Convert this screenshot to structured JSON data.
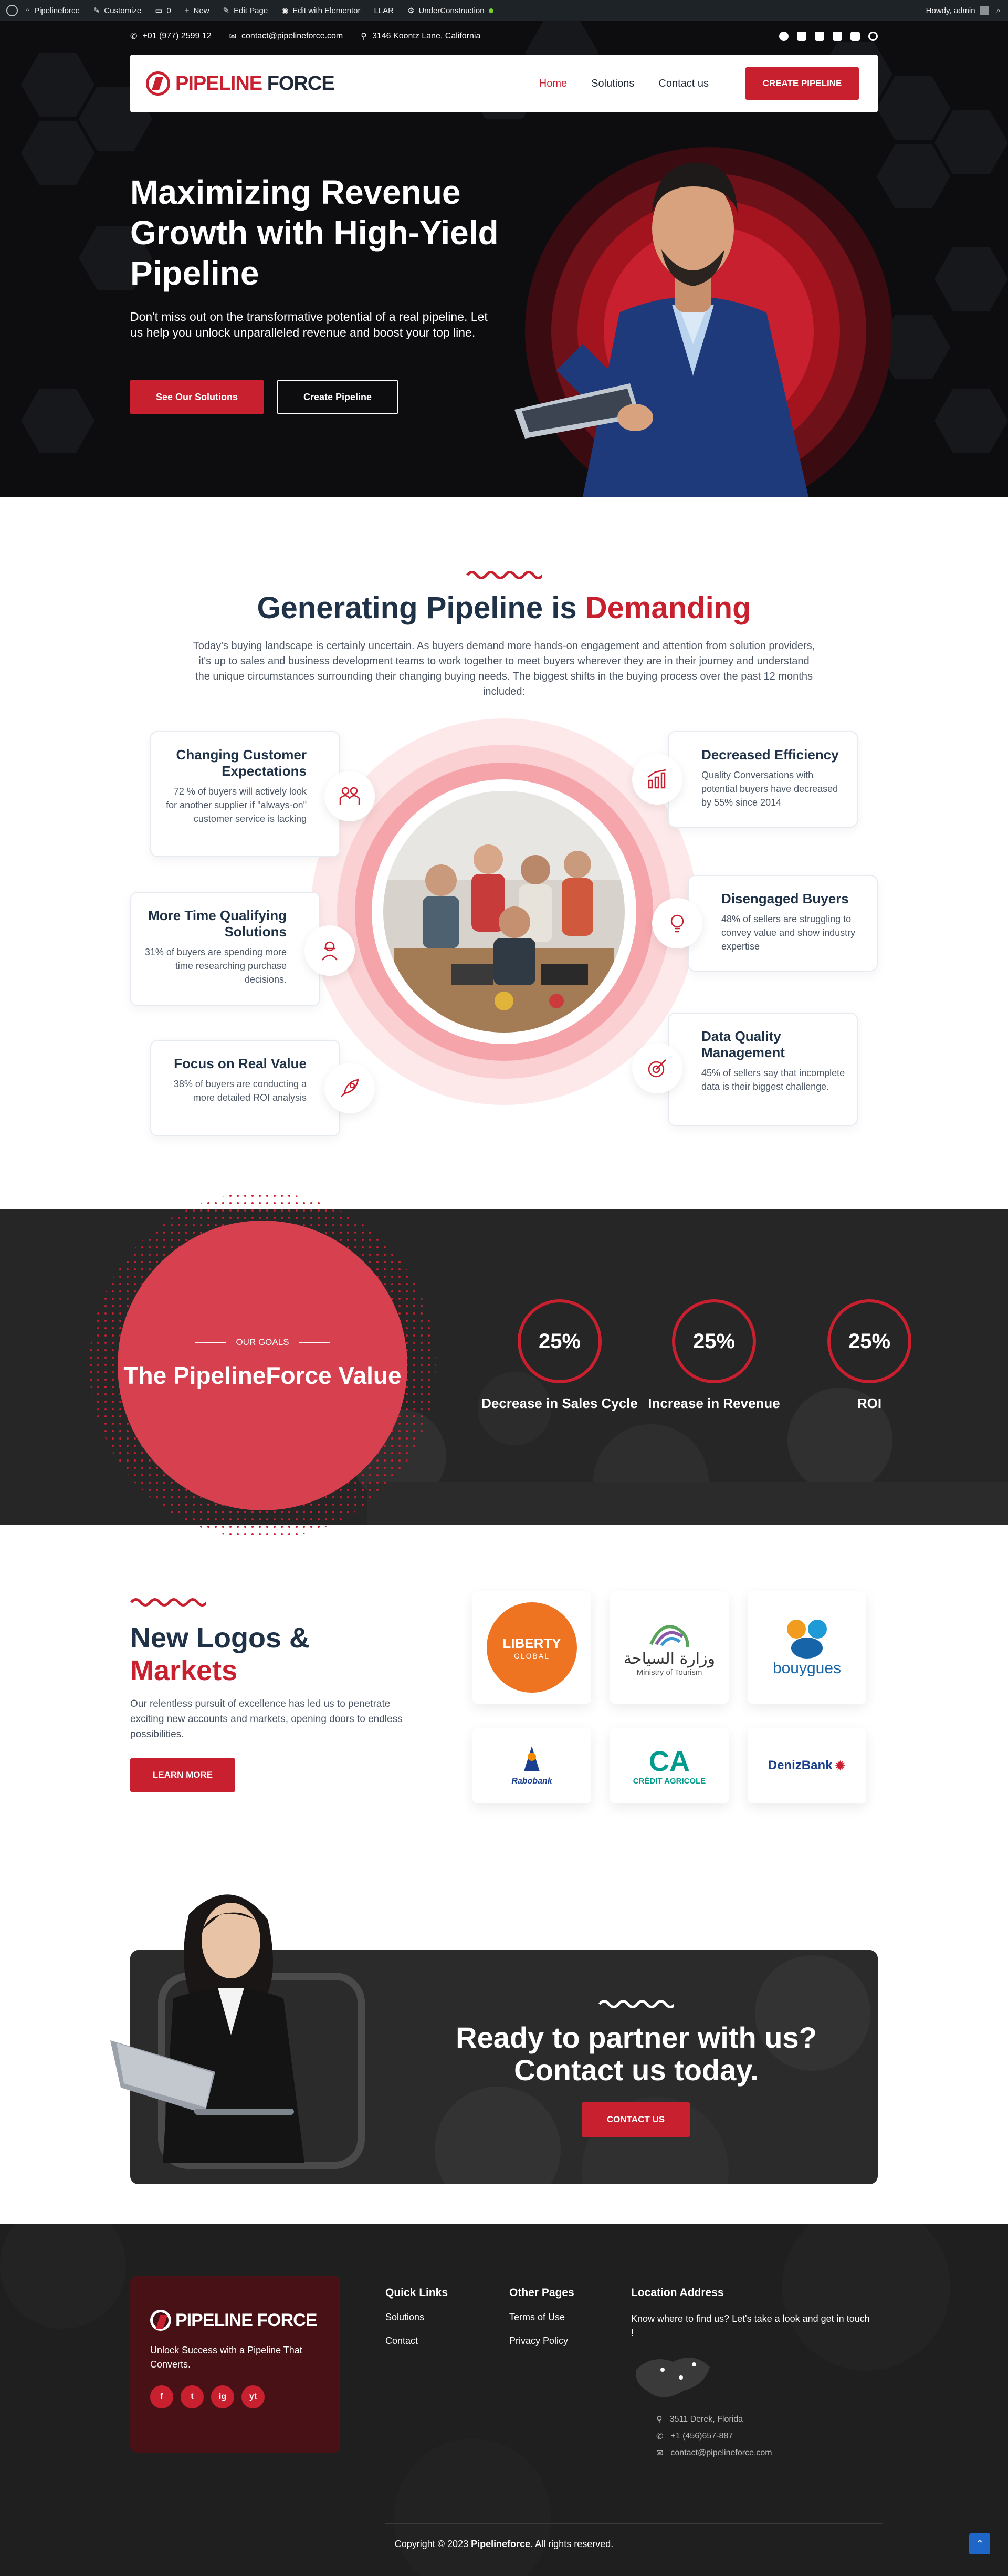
{
  "adminbar": {
    "items": [
      "Pipelineforce",
      "Customize",
      "0",
      "New",
      "Edit Page",
      "Edit with Elementor",
      "LLAR",
      "UnderConstruction"
    ],
    "greeting": "Howdy, admin"
  },
  "topbar": {
    "phone": "+01 (977) 2599 12",
    "email": "contact@pipelineforce.com",
    "address": "3146 Koontz Lane, California"
  },
  "brand": {
    "name_part1": "PIPELINE",
    "name_part2": "FORCE",
    "accent": "#c8202f",
    "dark": "#1f3247"
  },
  "nav": {
    "items": [
      "Home",
      "Solutions",
      "Contact us"
    ],
    "cta": "CREATE PIPELINE"
  },
  "hero": {
    "title": "Maximizing Revenue Growth with High-Yield Pipeline",
    "text": "Don't miss out on the transformative potential of a real pipeline. Let us help you unlock unparalleled revenue and boost your top line.",
    "btn_primary": "See Our Solutions",
    "btn_secondary": "Create Pipeline"
  },
  "generating": {
    "title_main": "Generating Pipeline is",
    "title_accent": "Demanding",
    "intro": "Today's buying landscape is certainly uncertain. As buyers demand more hands-on engagement and attention from solution providers, it's up to sales and business development teams to work together to meet buyers wherever they are in their journey and understand the unique circumstances surrounding their changing buying needs. The biggest shifts in the buying process over the past 12 months included:",
    "cards": [
      {
        "title": "Changing Customer Expectations",
        "text": "72 % of buyers will actively look for another supplier if \"always-on\" customer service is lacking",
        "icon": "people-icon"
      },
      {
        "title": "More Time Qualifying Solutions",
        "text": "31% of buyers are spending more time researching purchase decisions.",
        "icon": "person-search-icon"
      },
      {
        "title": "Focus on Real Value",
        "text": "38% of buyers are conducting a more detailed ROI analysis",
        "icon": "rocket-icon"
      },
      {
        "title": "Decreased Efficiency",
        "text": "Quality Conversations with potential buyers have decreased by 55% since 2014",
        "icon": "chart-icon"
      },
      {
        "title": "Disengaged Buyers",
        "text": "48% of sellers are struggling to convey value and show industry expertise",
        "icon": "bulb-icon"
      },
      {
        "title": "Data Quality Management",
        "text": "45% of sellers say that incomplete data is their biggest challenge.",
        "icon": "target-icon"
      }
    ]
  },
  "value": {
    "eyebrow": "OUR GOALS",
    "title": "The PipelineForce Value",
    "stats": [
      {
        "value": "25%",
        "label": "Decrease in Sales Cycle"
      },
      {
        "value": "25%",
        "label": "Increase in Revenue"
      },
      {
        "value": "25%",
        "label": "ROI"
      }
    ]
  },
  "logos": {
    "title_line1": "New Logos &",
    "title_line2": "Markets",
    "text": "Our relentless pursuit of excellence has led us to penetrate exciting new accounts and markets, opening doors to endless possibilities.",
    "button": "LEARN MORE",
    "items": [
      {
        "name": "LIBERTY",
        "sub": "GLOBAL"
      },
      {
        "name": "وزارة السياحة",
        "sub": "Ministry of Tourism"
      },
      {
        "name": "bouygues",
        "sub": ""
      },
      {
        "name": "Rabobank",
        "sub": ""
      },
      {
        "name": "CA",
        "sub": "CRÉDIT AGRICOLE"
      },
      {
        "name": "DenizBank",
        "sub": ""
      }
    ]
  },
  "cta": {
    "line1": "Ready to partner with us?",
    "line2": "Contact us today.",
    "button": "CONTACT US"
  },
  "footer": {
    "tagline": "Unlock Success with a Pipeline That Converts.",
    "social": [
      "f",
      "t",
      "ig",
      "yt"
    ],
    "quick_title": "Quick Links",
    "quick_links": [
      "Solutions",
      "Contact"
    ],
    "other_title": "Other Pages",
    "other_links": [
      "Terms of Use",
      "Privacy Policy"
    ],
    "loc_title": "Location Address",
    "loc_text": "Know where to find us? Let's take a look and get in touch !",
    "address": "3511 Derek, Florida",
    "phone": "+1 (456)657-887",
    "email": "contact@pipelineforce.com",
    "copyright_pre": "Copyright © 2023",
    "copyright_brand": "Pipelineforce.",
    "copyright_post": "All rights reserved."
  }
}
